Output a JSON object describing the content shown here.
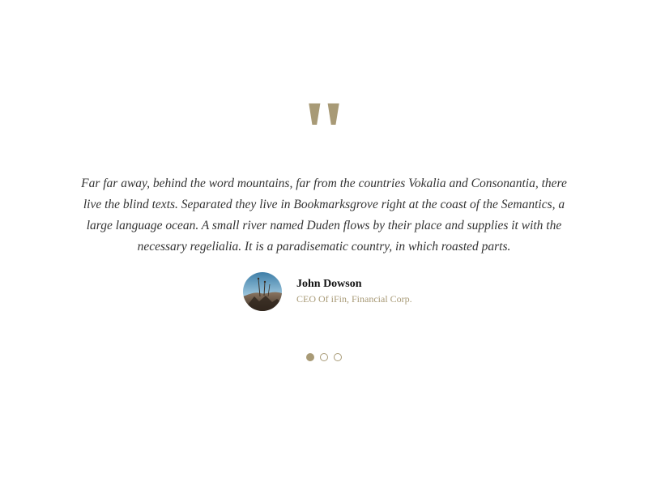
{
  "testimonial": {
    "quote_mark": "\"",
    "quote": "Far far away, behind the word mountains, far from the countries Vokalia and Consonantia, there live the blind texts. Separated they live in Bookmarksgrove right at the coast of the Semantics, a large language ocean. A small river named Duden flows by their place and supplies it with the necessary regelialia. It is a paradisematic country, in which roasted parts.",
    "author": {
      "name": "John Dowson",
      "role": "CEO Of iFin, Financial Corp.",
      "avatar_icon": "landscape-photo"
    }
  },
  "carousel": {
    "active_index": 0,
    "dots": [
      "slide-1",
      "slide-2",
      "slide-3"
    ]
  },
  "colors": {
    "accent": "#a89a76",
    "text": "#333333",
    "name": "#111111",
    "background": "#ffffff"
  }
}
